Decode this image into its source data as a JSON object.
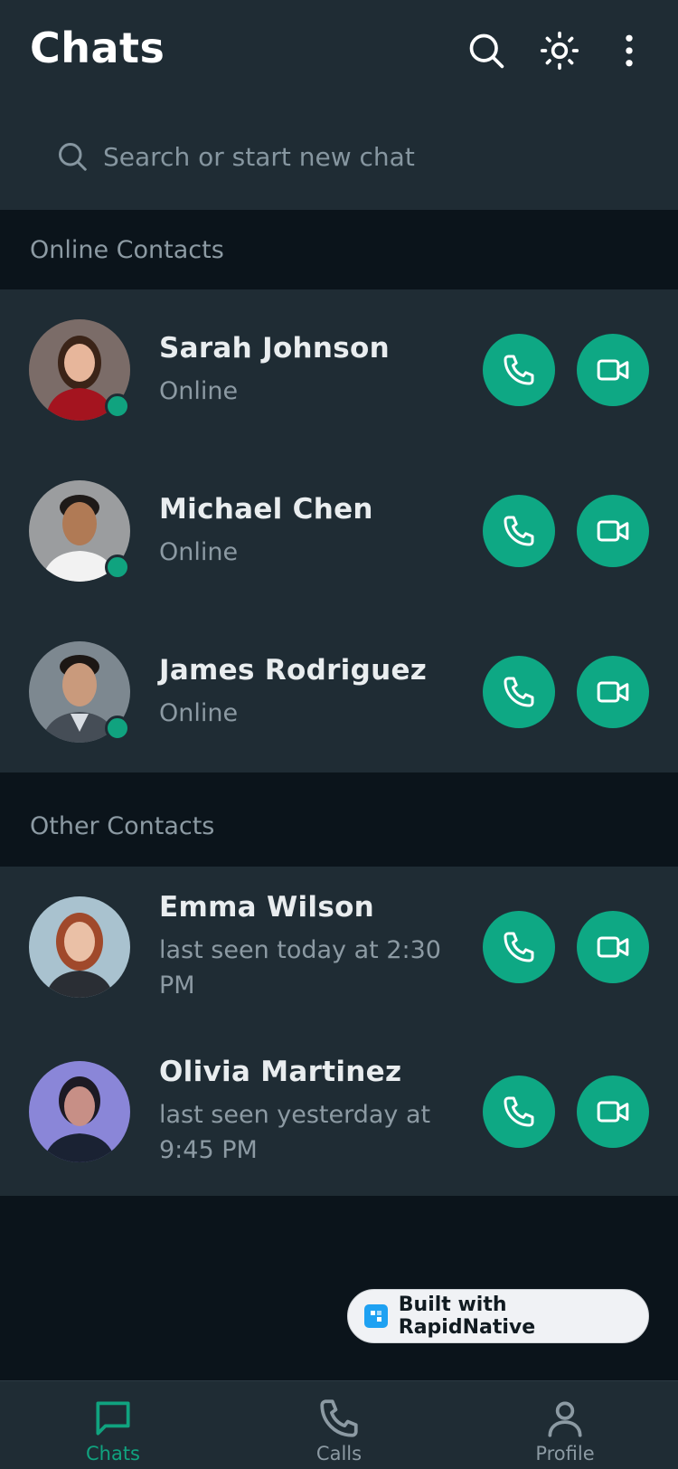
{
  "header": {
    "title": "Chats",
    "icons": [
      "search-icon",
      "brightness-icon",
      "more-vert-icon"
    ]
  },
  "search": {
    "placeholder": "Search or start new chat"
  },
  "sections": {
    "online_title": "Online Contacts",
    "other_title": "Other Contacts"
  },
  "online_contacts": [
    {
      "name": "Sarah Johnson",
      "status": "Online"
    },
    {
      "name": "Michael Chen",
      "status": "Online"
    },
    {
      "name": "James Rodriguez",
      "status": "Online"
    }
  ],
  "other_contacts": [
    {
      "name": "Emma Wilson",
      "status": "last seen today at 2:30 PM"
    },
    {
      "name": "Olivia Martinez",
      "status": "last seen yesterday at 9:45 PM"
    }
  ],
  "badge": {
    "text": "Built with RapidNative"
  },
  "tabs": [
    {
      "label": "Chats",
      "icon": "chat-icon",
      "active": true
    },
    {
      "label": "Calls",
      "icon": "phone-icon",
      "active": false
    },
    {
      "label": "Profile",
      "icon": "person-icon",
      "active": false
    }
  ],
  "colors": {
    "accent": "#0ea884",
    "header_bg": "#1f2c34",
    "page_bg": "#0b141b",
    "online_dot": "#10a37f"
  }
}
